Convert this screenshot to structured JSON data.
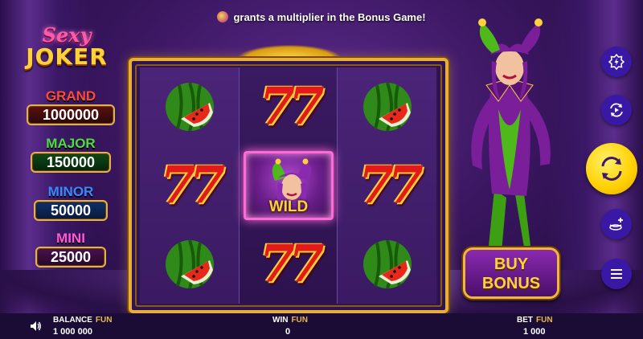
{
  "banner": {
    "text": "grants a multiplier in the Bonus Game!"
  },
  "logo": {
    "line1": "Sexy",
    "line2": "JOKER"
  },
  "jackpots": [
    {
      "label": "GRAND",
      "value": "1000000"
    },
    {
      "label": "MAJOR",
      "value": "150000"
    },
    {
      "label": "MINOR",
      "value": "50000"
    },
    {
      "label": "MINI",
      "value": "25000"
    }
  ],
  "reels": {
    "grid": [
      [
        "watermelon",
        "seven",
        "watermelon"
      ],
      [
        "seven",
        "wild",
        "seven"
      ],
      [
        "watermelon",
        "seven",
        "watermelon"
      ]
    ],
    "seven_label": "77",
    "wild_label": "WILD"
  },
  "buy_bonus": {
    "line1": "BUY",
    "line2": "BONUS"
  },
  "side_buttons": [
    "bonus-icon",
    "autoplay-icon",
    "spin-icon",
    "bet-coins-icon",
    "menu-icon"
  ],
  "status": {
    "balance_label": "BALANCE",
    "balance_currency": "FUN",
    "balance_value": "1 000 000",
    "win_label": "WIN",
    "win_currency": "FUN",
    "win_value": "0",
    "bet_label": "BET",
    "bet_currency": "FUN",
    "bet_value": "1 000"
  },
  "colors": {
    "accent_gold": "#e9ae3a",
    "spin_yellow": "#ffd000",
    "side_button_blue": "#3a18a6",
    "wild_glow": "#ff6ad8"
  }
}
